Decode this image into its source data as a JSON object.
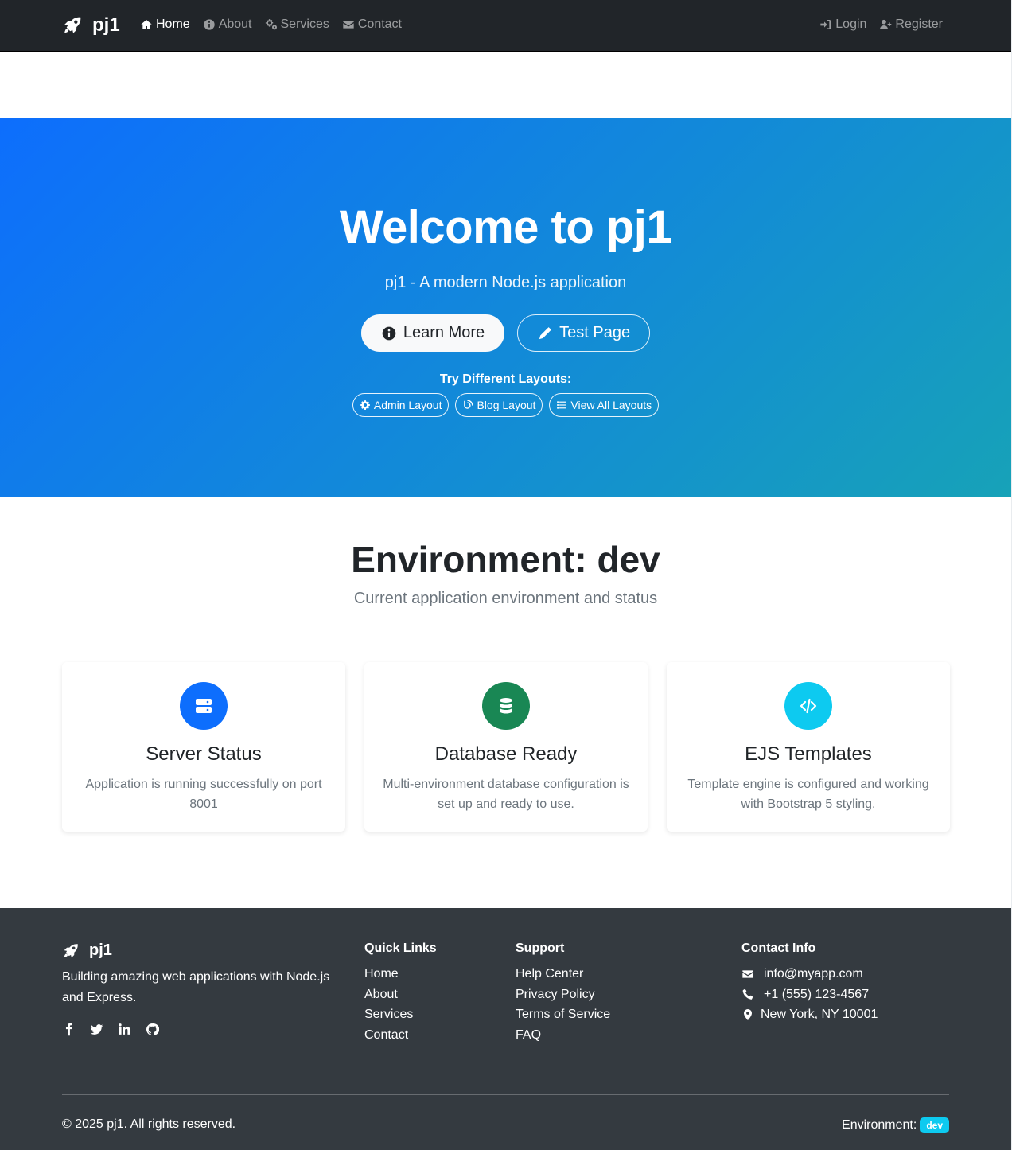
{
  "navbar": {
    "brand": "pj1",
    "links": [
      {
        "label": "Home",
        "icon": "home-icon",
        "active": true
      },
      {
        "label": "About",
        "icon": "info-circle-icon"
      },
      {
        "label": "Services",
        "icon": "gears-icon"
      },
      {
        "label": "Contact",
        "icon": "envelope-icon"
      }
    ],
    "right": [
      {
        "label": "Login",
        "icon": "sign-in-icon"
      },
      {
        "label": "Register",
        "icon": "user-plus-icon"
      }
    ]
  },
  "hero": {
    "title": "Welcome to pj1",
    "lead": "pj1 - A modern Node.js application",
    "learn_more": "Learn More",
    "test_page": "Test Page",
    "layouts_title": "Try Different Layouts:",
    "layout_buttons": [
      "Admin Layout",
      "Blog Layout",
      "View All Layouts"
    ],
    "gradient": [
      "#0d6efd",
      "#17a2b8"
    ]
  },
  "environment": {
    "title": "Environment: dev",
    "subtitle": "Current application environment and status",
    "cards": [
      {
        "title": "Server Status",
        "text": "Application is running successfully on port 8001",
        "icon": "server-icon",
        "color": "#0d6efd"
      },
      {
        "title": "Database Ready",
        "text": "Multi-environment database configuration is set up and ready to use.",
        "icon": "database-icon",
        "color": "#198754"
      },
      {
        "title": "EJS Templates",
        "text": "Template engine is configured and working with Bootstrap 5 styling.",
        "icon": "code-icon",
        "color": "#0dcaf0"
      }
    ]
  },
  "footer": {
    "brand": "pj1",
    "description": "Building amazing web applications with Node.js and Express.",
    "socials": [
      "facebook-icon",
      "twitter-icon",
      "linkedin-icon",
      "github-icon"
    ],
    "quick_links": {
      "title": "Quick Links",
      "items": [
        "Home",
        "About",
        "Services",
        "Contact"
      ]
    },
    "support": {
      "title": "Support",
      "items": [
        "Help Center",
        "Privacy Policy",
        "Terms of Service",
        "FAQ"
      ]
    },
    "contact": {
      "title": "Contact Info",
      "items": [
        {
          "icon": "envelope-icon",
          "text": "info@myapp.com"
        },
        {
          "icon": "phone-icon",
          "text": "+1 (555) 123-4567"
        },
        {
          "icon": "map-marker-icon",
          "text": "New York, NY 10001"
        }
      ]
    },
    "copyright": "© 2025 pj1. All rights reserved.",
    "env_label": "Environment:",
    "env_badge": "dev"
  }
}
